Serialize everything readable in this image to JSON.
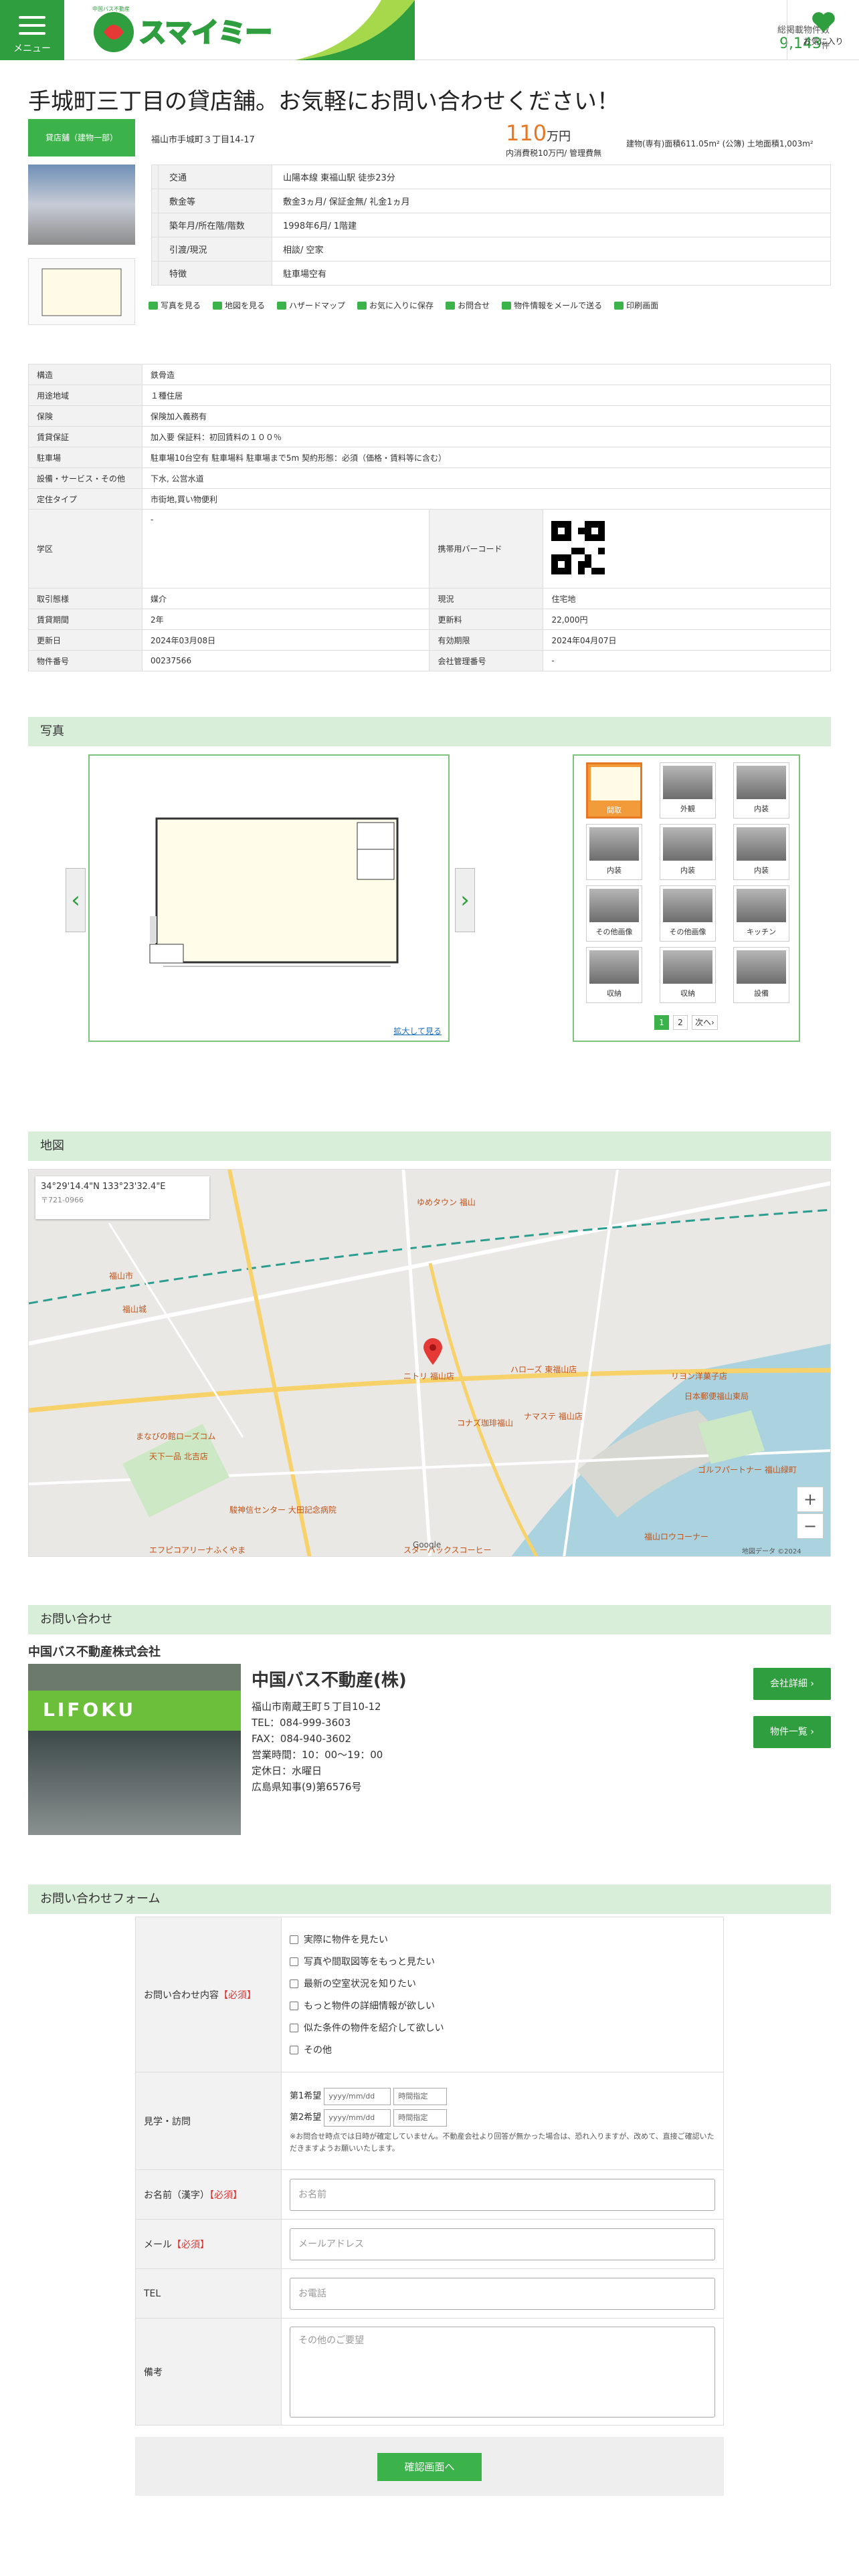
{
  "header": {
    "menu_label": "メニュー",
    "brand_small": "中国バス不動産",
    "brand": "スマイミー",
    "count_label": "総掲載物件数",
    "count_value": "9,143",
    "count_unit": "件",
    "fav_label": "お気に入り"
  },
  "title": "手城町三丁目の貸店舗。お気軽にお問い合わせください！",
  "category_tag": "貸店舗（建物一部）",
  "address": "福山市手城町３丁目14-17",
  "price": {
    "value": "110",
    "unit": "万円",
    "note": "内消費税10万円/ 管理費無"
  },
  "area_text": "建物(専有)面積611.05m² (公簿) 土地面積1,003m²",
  "summary": [
    {
      "k": "交通",
      "v": "山陽本線 東福山駅 徒歩23分"
    },
    {
      "k": "敷金等",
      "v": "敷金3ヵ月/ 保証金無/ 礼金1ヵ月"
    },
    {
      "k": "築年月/所在階/階数",
      "v": "1998年6月/ 1階建"
    },
    {
      "k": "引渡/現況",
      "v": "相談/ 空家"
    },
    {
      "k": "特徴",
      "v": "駐車場空有"
    }
  ],
  "tools": [
    "写真を見る",
    "地図を見る",
    "ハザードマップ",
    "お気に入りに保存",
    "お問合せ",
    "物件情報をメールで送る",
    "印刷画面"
  ],
  "details": {
    "rows1": [
      {
        "k": "構造",
        "v": "鉄骨造"
      },
      {
        "k": "用途地域",
        "v": "１種住居"
      },
      {
        "k": "保険",
        "v": "保険加入義務有"
      },
      {
        "k": "賃貸保証",
        "v": "加入要 保証料：初回賃料の１００％"
      },
      {
        "k": "駐車場",
        "v": "駐車場10台空有 駐車場料 駐車場まで5m 契約形態：必須（価格・賃料等に含む）"
      },
      {
        "k": "設備・サービス・その他",
        "v": "下水, 公営水道"
      },
      {
        "k": "定住タイプ",
        "v": "市街地,買い物便利"
      }
    ],
    "school": {
      "k": "学区",
      "v": "-",
      "k2": "携帯用バーコード"
    },
    "rows2": [
      {
        "k": "取引態様",
        "v": "媒介",
        "k2": "現況",
        "v2": "住宅地"
      },
      {
        "k": "賃貸期間",
        "v": "2年",
        "k2": "更新料",
        "v2": "22,000円"
      },
      {
        "k": "更新日",
        "v": "2024年03月08日",
        "k2": "有効期限",
        "v2": "2024年04月07日"
      },
      {
        "k": "物件番号",
        "v": "00237566",
        "k2": "会社管理番号",
        "v2": "-"
      }
    ]
  },
  "sections": {
    "photos": "写真",
    "map": "地図",
    "contact": "お問い合わせ",
    "form": "お問い合わせフォーム"
  },
  "gallery": {
    "zoom": "拡大して見る",
    "thumbs": [
      "間取",
      "外観",
      "内装",
      "内装",
      "内装",
      "内装",
      "その他画像",
      "その他画像",
      "キッチン",
      "収納",
      "収納",
      "設備"
    ],
    "pages": [
      "1",
      "2",
      "次へ›"
    ]
  },
  "map": {
    "coord": "34°29'14.4\"N 133°23'32.4\"E",
    "postal": "〒721-0966",
    "labels": [
      "ゆめタウン 福山",
      "福山城",
      "福山市",
      "ニトリ 福山店",
      "ハローズ 東福山店",
      "リヨン洋菓子店",
      "日本郵便福山東局",
      "ナマステ 福山店",
      "コナズ珈琲福山",
      "ゴルフパートナー 福山緑町",
      "スターバックスコーヒー",
      "福山ロウコーナー",
      "エフピコアリーナふくやま",
      "駿神信センター 大田記念病院",
      "まなびの館ローズコム",
      "天下一品 北吉店"
    ],
    "zoom_in": "+",
    "zoom_out": "−",
    "attribution": "Google",
    "map_data": "地図データ ©2024"
  },
  "company": {
    "corp_name": "中国バス不動産株式会社",
    "sign": "LIFOKU",
    "name": "中国バス不動産(株)",
    "address": "福山市南蔵王町５丁目10-12",
    "tel": "TEL：084-999-3603",
    "fax": "FAX：084-940-3602",
    "hours": "営業時間：10：00～19：00",
    "closed": "定休日：水曜日",
    "license": "広島県知事(9)第6576号",
    "btn_detail": "会社詳細 ›",
    "btn_list": "物件一覧 ›"
  },
  "form": {
    "q_label": "お問い合わせ内容",
    "required": "【必須】",
    "options": [
      "実際に物件を見たい",
      "写真や間取図等をもっと見たい",
      "最新の空室状況を知りたい",
      "もっと物件の詳細情報が欲しい",
      "似た条件の物件を紹介して欲しい",
      "その他"
    ],
    "visit_label": "見学・訪問",
    "first": "第1希望",
    "second": "第2希望",
    "date_ph": "yyyy/mm/dd",
    "time_ph": "時間指定",
    "visit_note": "※お問合せ時点では日時が確定していません。不動産会社より回答が無かった場合は、恐れ入りますが、改めて、直接ご確認いただきますようお願いいたします。",
    "name_label": "お名前（漢字）",
    "name_ph": "お名前",
    "mail_label": "メール",
    "mail_ph": "メールアドレス",
    "tel_label": "TEL",
    "tel_ph": "お電話",
    "memo_label": "備考",
    "memo_ph": "その他のご要望",
    "submit": "確認画面へ"
  }
}
